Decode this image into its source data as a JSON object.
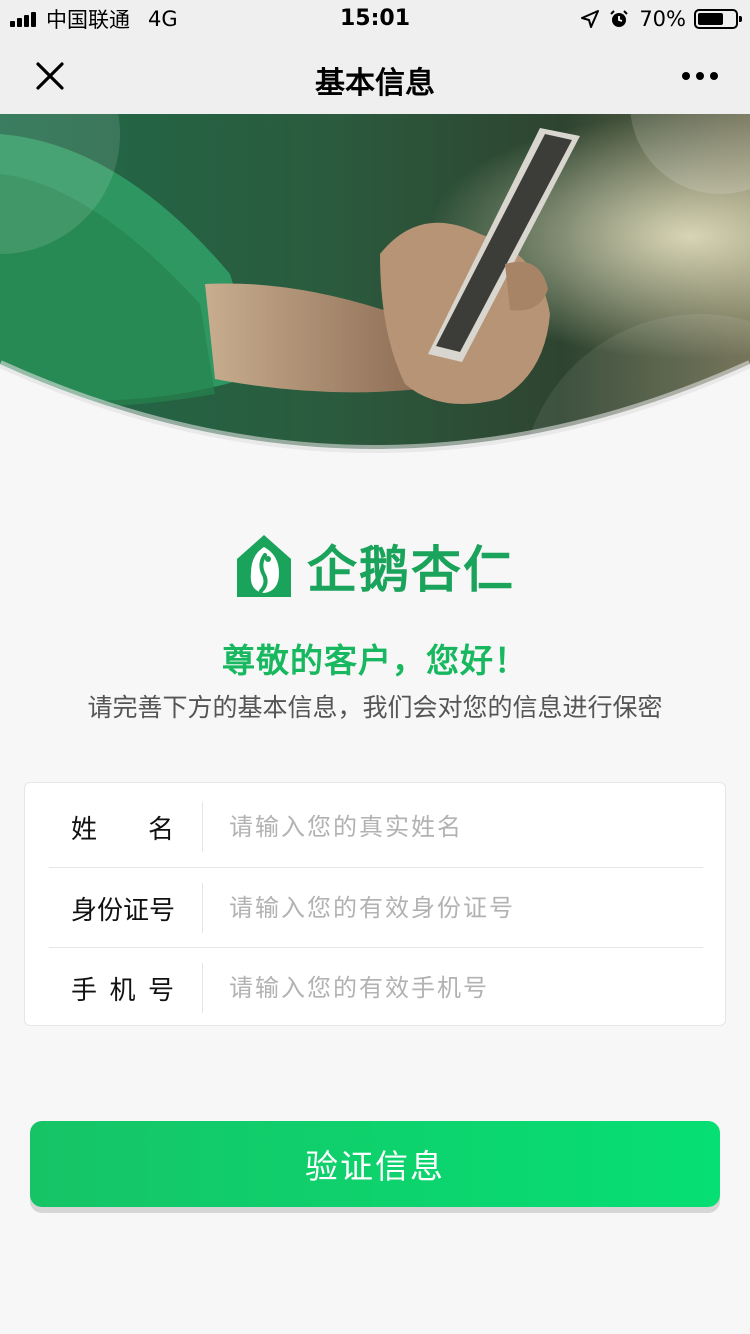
{
  "status_bar": {
    "carrier": "中国联通",
    "network": "4G",
    "time": "15:01",
    "battery": "70%",
    "battery_level": 0.7
  },
  "nav": {
    "title": "基本信息",
    "close_icon": "close-icon",
    "more_icon": "more-dots-icon"
  },
  "brand": {
    "name": "企鹅杏仁",
    "greeting": "尊敬的客户，您好！",
    "subtitle": "请完善下方的基本信息，我们会对您的信息进行保密"
  },
  "form": {
    "name": {
      "label_chars": [
        "姓",
        "名"
      ],
      "placeholder": "请输入您的真实姓名",
      "value": ""
    },
    "id_number": {
      "label": "身份证号",
      "placeholder": "请输入您的有效身份证号",
      "value": ""
    },
    "phone": {
      "label_chars": [
        "手",
        "机",
        "号"
      ],
      "placeholder": "请输入您的有效手机号",
      "value": ""
    }
  },
  "submit": {
    "label": "验证信息"
  },
  "colors": {
    "brand_green": "#1aa35a",
    "button_green": "#06df73",
    "greeting_green": "#17b85f"
  }
}
